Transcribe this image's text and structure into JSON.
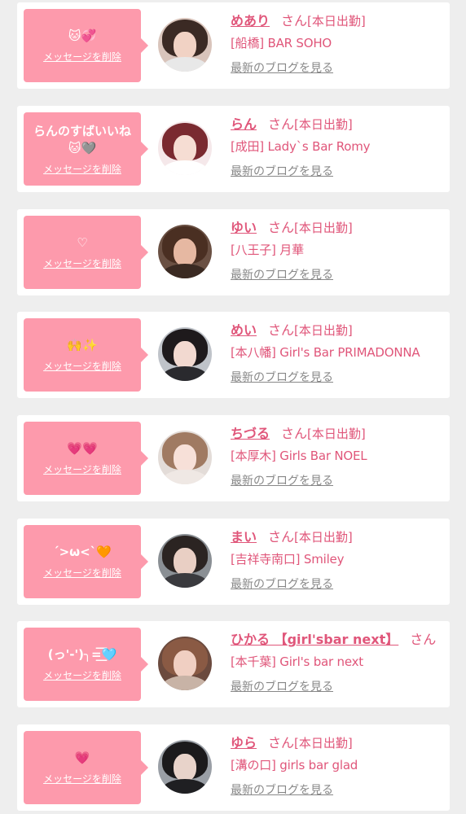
{
  "actions": {
    "delete_label": "メッセージを削除",
    "blog_label": "最新のブログを見る",
    "san_label": "さん",
    "status_label": "[本日出勤]"
  },
  "colors": {
    "bubble": "#fd9aac",
    "accent": "#e0567a",
    "link_gray": "#888888",
    "background": "#eeeeee"
  },
  "entries": [
    {
      "message": "🐱💞",
      "name": "めあり",
      "shop": "[船橋] BAR SOHO",
      "avatar": {
        "bg": "#d9c4bb",
        "hair": "#3b2a24",
        "skin": "#f1d2c4",
        "top": "#e8e8e8"
      }
    },
    {
      "message": "らんのすばいいね\n🐱🩶",
      "name": "らん",
      "shop": "[成田] Lady`s Bar Romy",
      "avatar": {
        "bg": "#f5e8ea",
        "hair": "#7a2a30",
        "skin": "#f6ddd3",
        "top": "#ffffff"
      }
    },
    {
      "message": "♡",
      "name": "ゆい",
      "shop": "[八王子] 月華",
      "avatar": {
        "bg": "#6a5043",
        "hair": "#4a2f22",
        "skin": "#e6b8a2",
        "top": "#3a2a22"
      }
    },
    {
      "message": "🙌✨",
      "name": "めい",
      "shop": "[本八幡] Girl's Bar PRIMADONNA",
      "avatar": {
        "bg": "#bfc3c9",
        "hair": "#1e1a1c",
        "skin": "#f2d9d0",
        "top": "#2a2a2e"
      }
    },
    {
      "message": "💗💗",
      "name": "ちづる",
      "shop": "[本厚木] Girls Bar NOEL",
      "avatar": {
        "bg": "#e3dcd8",
        "hair": "#a07a62",
        "skin": "#f7e0d8",
        "top": "#efe8e4"
      }
    },
    {
      "message": "´>ω<`🧡",
      "name": "まい",
      "shop": "[吉祥寺南口] Smiley",
      "avatar": {
        "bg": "#8a8f94",
        "hair": "#2b2422",
        "skin": "#e9cfc4",
        "top": "#3a3a3e"
      }
    },
    {
      "message": "(っ'-')╮=͟͟͞͞🩵",
      "name": "ひかる 【girl'sbar next】",
      "shop": "[本千葉] Girl's bar next",
      "avatar": {
        "bg": "#6b4a3e",
        "hair": "#8a5a44",
        "skin": "#f0cfc2",
        "top": "#c8b3a6"
      }
    },
    {
      "message": "💗",
      "name": "ゆら",
      "shop": "[溝の口] girls bar glad",
      "avatar": {
        "bg": "#9a9fa6",
        "hair": "#1b1a1c",
        "skin": "#e8d3ca",
        "top": "#1f1f22"
      }
    }
  ]
}
